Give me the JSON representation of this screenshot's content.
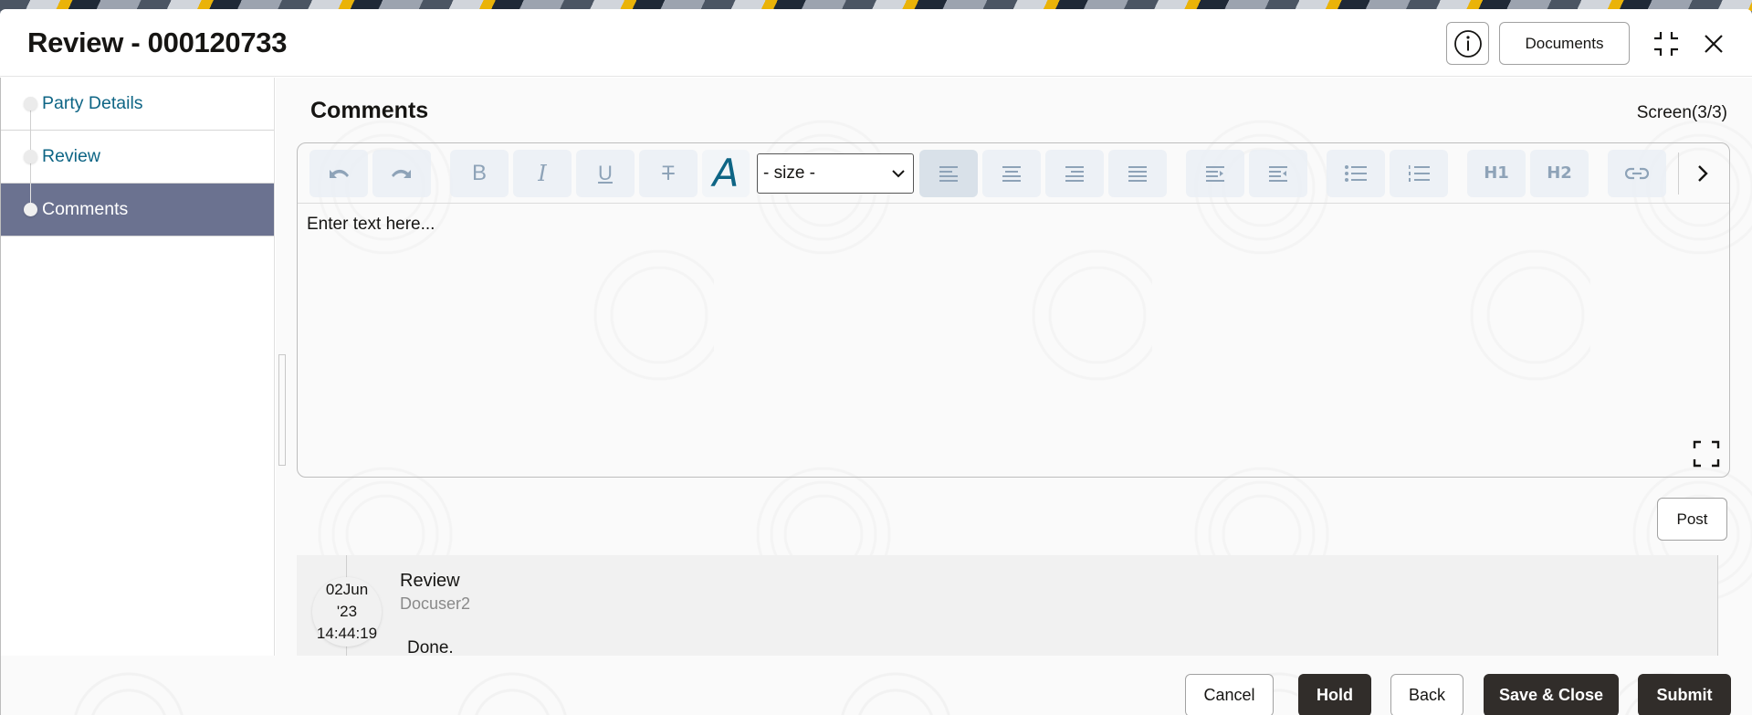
{
  "header": {
    "title": "Review - 000120733",
    "info_icon": "info-circle-icon",
    "documents_label": "Documents",
    "minimize_icon": "collapse-icon",
    "close_icon": "close-icon"
  },
  "sidebar": {
    "items": [
      {
        "label": "Party Details",
        "active": false
      },
      {
        "label": "Review",
        "active": false
      },
      {
        "label": "Comments",
        "active": true
      }
    ]
  },
  "main": {
    "section_title": "Comments",
    "screen_indicator": "Screen(3/3)",
    "editor": {
      "toolbar": {
        "undo_icon": "undo-icon",
        "redo_icon": "redo-icon",
        "bold_label": "B",
        "italic_label": "I",
        "underline_label": "U",
        "strike_label": "T",
        "font_label": "A",
        "size_selected": "- size -",
        "align_left_icon": "align-left-icon",
        "align_center_icon": "align-center-icon",
        "align_right_icon": "align-right-icon",
        "justify_icon": "align-justify-icon",
        "indent_icon": "indent-icon",
        "outdent_icon": "outdent-icon",
        "bullet_list_icon": "bullet-list-icon",
        "numbered_list_icon": "numbered-list-icon",
        "h1_label": "H1",
        "h2_label": "H2",
        "link_icon": "link-icon",
        "more_icon": "chevron-right-icon"
      },
      "placeholder": "Enter text here...",
      "expand_icon": "expand-icon"
    },
    "post_label": "Post",
    "comments": [
      {
        "date_line1": "02Jun",
        "date_line2": "'23",
        "time": "14:44:19",
        "title": "Review",
        "user": "Docuser2",
        "text": "Done."
      }
    ]
  },
  "footer": {
    "cancel_label": "Cancel",
    "hold_label": "Hold",
    "back_label": "Back",
    "save_close_label": "Save & Close",
    "submit_label": "Submit"
  },
  "colors": {
    "sidebar_active_bg": "#6b7290",
    "link_text": "#0e6585",
    "primary_button_bg": "#312d2a"
  }
}
